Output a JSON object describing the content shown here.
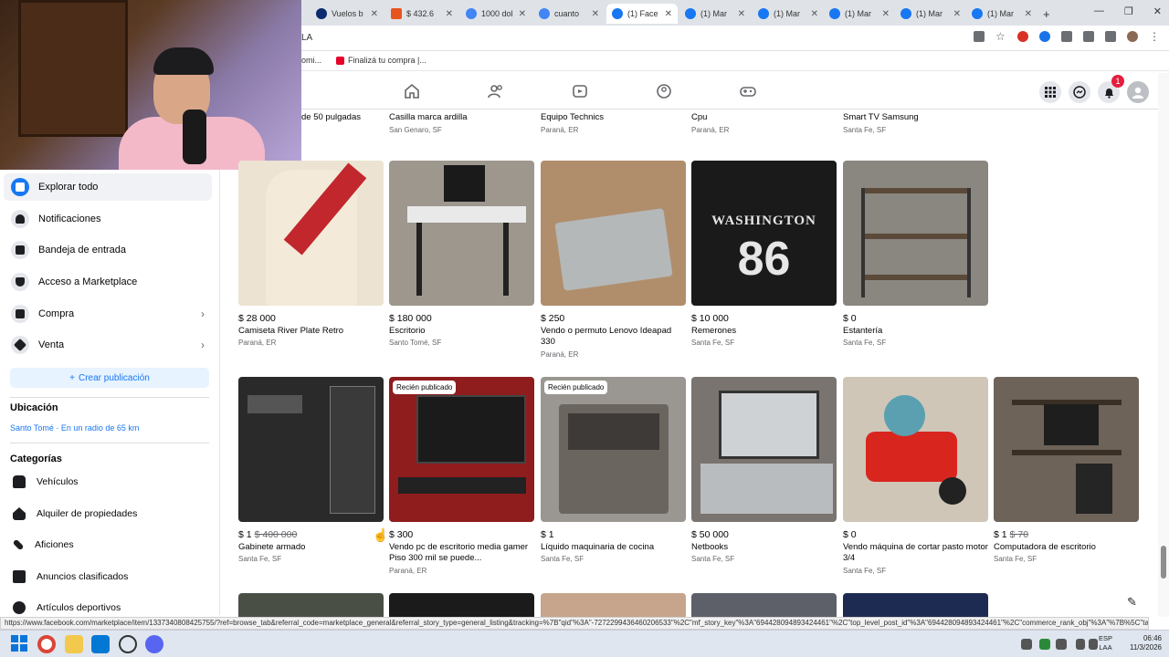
{
  "browser": {
    "tabs": [
      {
        "label": "Vuelos b",
        "color": "#0b2a6f"
      },
      {
        "label": "$ 432.6",
        "color": "#e8541e"
      },
      {
        "label": "1000 dol",
        "color": "#4285f4"
      },
      {
        "label": "cuanto",
        "color": "#4285f4"
      },
      {
        "label": "(1) Face",
        "color": "#1877f2"
      },
      {
        "label": "(1) Mar",
        "color": "#1877f2"
      },
      {
        "label": "(1) Mar",
        "color": "#1877f2"
      },
      {
        "label": "(1) Mar",
        "color": "#1877f2"
      },
      {
        "label": "(1) Mar",
        "color": "#1877f2"
      },
      {
        "label": "(1) Mar",
        "color": "#1877f2"
      }
    ],
    "new_tab": "+",
    "url_fragment": "LA",
    "bookmarks": [
      {
        "label": "omi..."
      },
      {
        "label": "Finalizá tu compra |..."
      }
    ]
  },
  "fb": {
    "notification_count": "1"
  },
  "sidebar": {
    "items": [
      {
        "label": "Explorar todo",
        "icon": "storefront-icon"
      },
      {
        "label": "Notificaciones",
        "icon": "bell-icon"
      },
      {
        "label": "Bandeja de entrada",
        "icon": "inbox-icon"
      },
      {
        "label": "Acceso a Marketplace",
        "icon": "shield-icon"
      },
      {
        "label": "Compra",
        "icon": "bag-icon"
      },
      {
        "label": "Venta",
        "icon": "tag-icon"
      }
    ],
    "create_label": "Crear publicación",
    "location_heading": "Ubicación",
    "location_value": "Santo Tomé · En un radio de 65 km",
    "categories_heading": "Categorías",
    "categories": [
      {
        "label": "Vehículos"
      },
      {
        "label": "Alquiler de propiedades"
      },
      {
        "label": "Aficiones"
      },
      {
        "label": "Anuncios clasificados"
      },
      {
        "label": "Artículos deportivos"
      }
    ]
  },
  "top_partial": [
    {
      "title": "de 50 pulgadas"
    },
    {
      "title": "Casilla marca ardilla",
      "loc": "San Genaro, SF"
    },
    {
      "title": "Equipo Technics",
      "loc": "Paraná, ER"
    },
    {
      "title": "Cpu",
      "loc": "Paraná, ER"
    },
    {
      "title": "Smart TV Samsung",
      "loc": "Santa Fe, SF"
    }
  ],
  "row1": [
    {
      "price": "$ 28 000",
      "title": "Camiseta River Plate Retro",
      "loc": "Paraná, ER",
      "bg": "#ece3d2",
      "accent": "#c1272d"
    },
    {
      "price": "$ 180 000",
      "title": "Escritorio",
      "loc": "Santo Tomé, SF",
      "bg": "#9d978e",
      "accent": "#222222"
    },
    {
      "price": "$ 250",
      "title": "Vendo o permuto Lenovo Ideapad 330",
      "loc": "Paraná, ER",
      "bg": "#b08e6c",
      "accent": "#b5b8b8"
    },
    {
      "price": "$ 10 000",
      "title": "Remerones",
      "loc": "Santa Fe, SF",
      "bg": "#1a1a1a",
      "accent": "#e6e6e6"
    },
    {
      "price": "$ 0",
      "title": "Estantería",
      "loc": "Santa Fe, SF",
      "bg": "#8a8680",
      "accent": "#5b4a3a"
    }
  ],
  "row2": [
    {
      "price": "$ 1",
      "old_price": "$ 400 000",
      "title": "Gabinete armado",
      "loc": "Santa Fe, SF",
      "bg": "#2a2a2a",
      "accent": "#dcdcdc",
      "badge": ""
    },
    {
      "price": "$ 300",
      "old_price": "",
      "title": "Vendo pc de escritorio media gamer Piso 300 mil se puede...",
      "loc": "Paraná, ER",
      "bg": "#8f1d1d",
      "accent": "#1b1b1b",
      "badge": "Recién publicado"
    },
    {
      "price": "$ 1",
      "old_price": "",
      "title": "Líquido maquinaria de cocina",
      "loc": "Santa Fe, SF",
      "bg": "#9a9691",
      "accent": "#6b6560",
      "badge": "Recién publicado"
    },
    {
      "price": "$ 50 000",
      "old_price": "",
      "title": "Netbooks",
      "loc": "Santa Fe, SF",
      "bg": "#7a7470",
      "accent": "#cfd2d4",
      "badge": ""
    },
    {
      "price": "$ 0",
      "old_price": "",
      "title": "Vendo máquina de cortar pasto motor 3/4",
      "loc": "Santa Fe, SF",
      "bg": "#cfc6b8",
      "accent": "#d8261f",
      "badge": ""
    },
    {
      "price": "$ 1",
      "old_price": "$ 70",
      "title": "Computadora de escritorio",
      "loc": "Santa Fe, SF",
      "bg": "#6d6358",
      "accent": "#3a2f25",
      "badge": ""
    }
  ],
  "status_url": "https://www.facebook.com/marketplace/item/1337340808425755/?ref=browse_tab&referral_code=marketplace_general&referral_story_type=general_listing&tracking=%7B\"qid\"%3A\"-7272299436460206533\"%2C\"mf_story_key\"%3A\"694428094893424461\"%2C\"top_level_post_id\"%3A\"694428094893424461\"%2C\"commerce_rank_obj\"%3A\"%7B%5C\"target_...",
  "taskbar": {
    "lang": "ESP",
    "lang2": "LAA",
    "time": "06:46",
    "date": "11/3/2026"
  }
}
